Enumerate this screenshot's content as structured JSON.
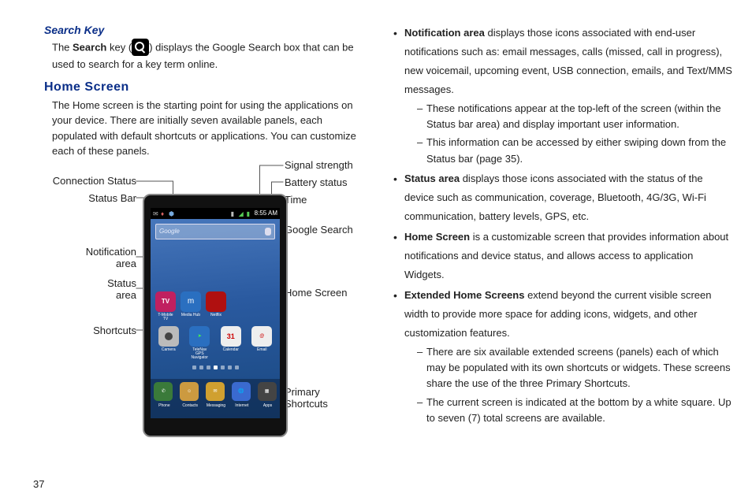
{
  "left": {
    "heading_search_key": "Search Key",
    "search_p_prefix": "The ",
    "search_label": "Search",
    "search_p_mid": " key (",
    "search_p_suffix": ") displays the Google Search box that can be used to search for a key term online.",
    "heading_home": "Home Screen",
    "home_p": "The Home screen is the starting point for using the applications on your device. There are initially seven available panels, each populated with default shortcuts or applications. You can customize each of these panels.",
    "labels": {
      "connection_status": "Connection Status",
      "status_bar": "Status Bar",
      "notification_area": "Notification\narea",
      "status_area": "Status\narea",
      "shortcuts": "Shortcuts",
      "signal_strength": "Signal strength",
      "battery_status": "Battery status",
      "time": "Time",
      "google_search": "Google Search",
      "home_screen": "Home Screen",
      "primary_shortcuts": "Primary\nShortcuts"
    },
    "phone": {
      "time": "8:55 AM",
      "google": "Google",
      "row1": [
        "T-Mobile TV",
        "Media Hub",
        "Netflix"
      ],
      "row2": [
        "Camera",
        "TeleNav GPS Navigator",
        "Calendar",
        "Email"
      ],
      "dock": [
        "Phone",
        "Contacts",
        "Messaging",
        "Internet",
        "Apps"
      ]
    }
  },
  "right": {
    "b1_term": "Notification area",
    "b1_txt": " displays those icons associated with end-user notifications such as: email messages, calls (missed, call in progress), new voicemail, upcoming event, USB connection, emails, and Text/MMS messages.",
    "b1_d1": "These notifications appear at the top-left of the screen (within the Status bar area) and display important user information.",
    "b1_d2": "This information can be accessed by either swiping down from the Status bar (page 35).",
    "b2_term": "Status area",
    "b2_txt": " displays those icons associated with the status of the device such as communication, coverage, Bluetooth, 4G/3G, Wi-Fi communication, battery levels, GPS, etc.",
    "b3_term": "Home Screen",
    "b3_txt": " is a customizable screen that provides information about notifications and device status, and allows access to application Widgets.",
    "b4_term": "Extended Home Screens",
    "b4_txt": " extend beyond the current visible screen width to provide more space for adding icons, widgets, and other customization features.",
    "b4_d1": "There are six available extended screens (panels) each of which may be populated with its own shortcuts or widgets. These screens share the use of the three Primary Shortcuts.",
    "b4_d2": "The current screen is indicated at the bottom by a white square. Up to seven (7) total screens are available."
  },
  "page_number": "37"
}
